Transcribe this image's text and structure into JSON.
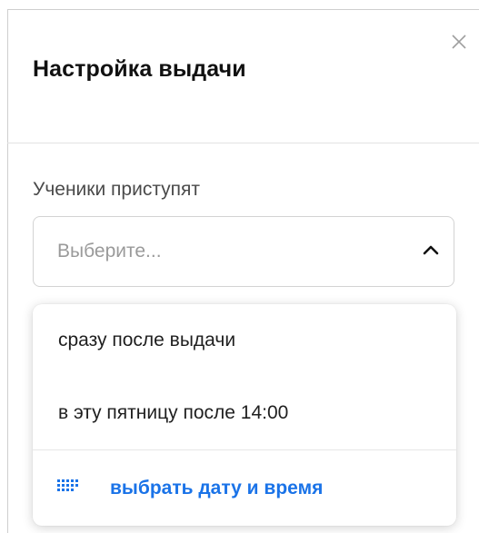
{
  "dialog": {
    "title": "Настройка выдачи",
    "close_icon": "close-icon"
  },
  "field": {
    "label": "Ученики приступят",
    "placeholder": "Выберите...",
    "expanded": true,
    "chevron_icon": "chevron-up-icon"
  },
  "dropdown": {
    "options": [
      {
        "label": "сразу после выдачи"
      },
      {
        "label": "в эту пятницу после 14:00"
      }
    ],
    "action": {
      "label": "выбрать дату и время",
      "icon": "calendar-grid-icon"
    }
  },
  "colors": {
    "accent": "#1a73e8",
    "text": "#1a1a1a",
    "muted": "#9a9a9a",
    "border": "#d3d3d3"
  }
}
